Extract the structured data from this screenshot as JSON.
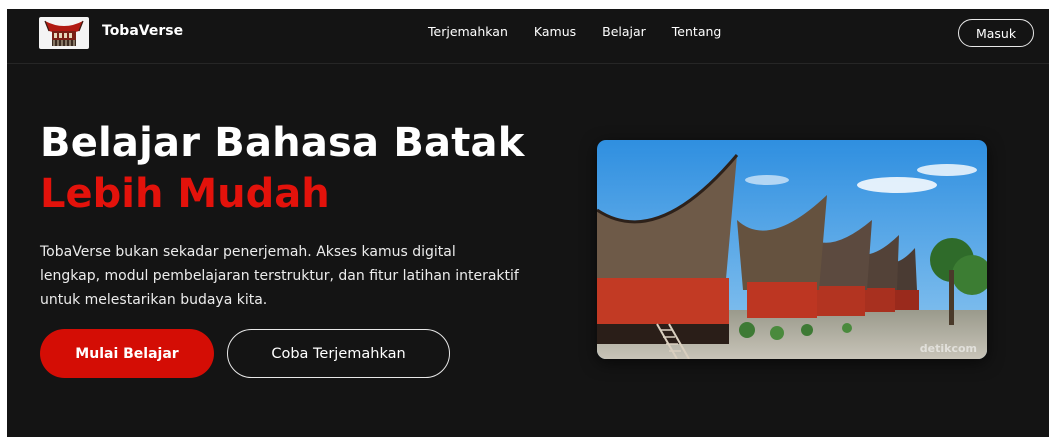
{
  "nav": {
    "brand": "TobaVerse",
    "links": [
      "Terjemahkan",
      "Kamus",
      "Belajar",
      "Tentang"
    ],
    "login_label": "Masuk"
  },
  "hero": {
    "title_line1": "Belajar Bahasa Batak",
    "title_line2": "Lebih Mudah",
    "description": "TobaVerse bukan sekadar penerjemah. Akses kamus digital lengkap, modul pembelajaran terstruktur, dan fitur latihan interaktif untuk melestarikan budaya kita.",
    "primary_button": "Mulai Belajar",
    "secondary_button": "Coba Terjemahkan",
    "image_watermark": "detikcom"
  },
  "colors": {
    "background": "#141414",
    "accent": "#d40d05",
    "title_red": "#e3120b",
    "text": "#ffffff"
  },
  "icons": {
    "logo": "batak-house-logo-icon"
  }
}
